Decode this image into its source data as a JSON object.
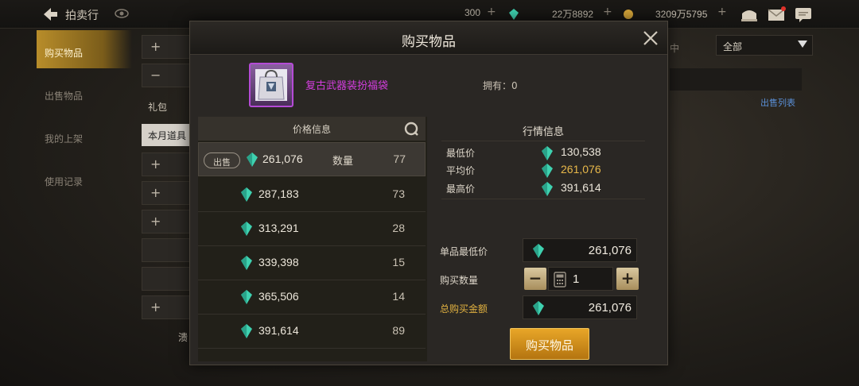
{
  "topbar": {
    "title": "拍卖行",
    "currency_1": "300",
    "currency_2": "22万8892",
    "currency_3": "3209万5795"
  },
  "sidebar": {
    "items": [
      {
        "label": "购买物品"
      },
      {
        "label": "出售物品"
      },
      {
        "label": "我的上架"
      },
      {
        "label": "使用记录"
      }
    ]
  },
  "background": {
    "row_label_1": "礼包",
    "row_label_2": "本月道具",
    "row_label_3": "溃",
    "dropdown_value": "全部",
    "right_fragment": "中",
    "sale_list_link": "出售列表"
  },
  "modal": {
    "title": "购买物品",
    "item_name": "复古武器装扮福袋",
    "owned_label": "拥有：",
    "owned_count": "0",
    "price_header": "价格信息",
    "sell_tag": "出售",
    "qty_label": "数量",
    "listings": [
      {
        "price": "261,076",
        "qty": "77"
      },
      {
        "price": "287,183",
        "qty": "73"
      },
      {
        "price": "313,291",
        "qty": "28"
      },
      {
        "price": "339,398",
        "qty": "15"
      },
      {
        "price": "365,506",
        "qty": "14"
      },
      {
        "price": "391,614",
        "qty": "89"
      }
    ],
    "market": {
      "title": "行情信息",
      "min_label": "最低价",
      "min_value": "130,538",
      "avg_label": "平均价",
      "avg_value": "261,076",
      "max_label": "最高价",
      "max_value": "391,614"
    },
    "purchase": {
      "unit_min_label": "单品最低价",
      "unit_min_value": "261,076",
      "qty_label": "购买数量",
      "qty_value": "1",
      "total_label": "总购买金额",
      "total_value": "261,076",
      "buy_button": "购买物品"
    }
  },
  "colors": {
    "gold_accent": "#e0b040",
    "item_purple": "#d53ee0",
    "gem_teal": "#3fd1b0",
    "link_blue": "#5a8fd6"
  }
}
